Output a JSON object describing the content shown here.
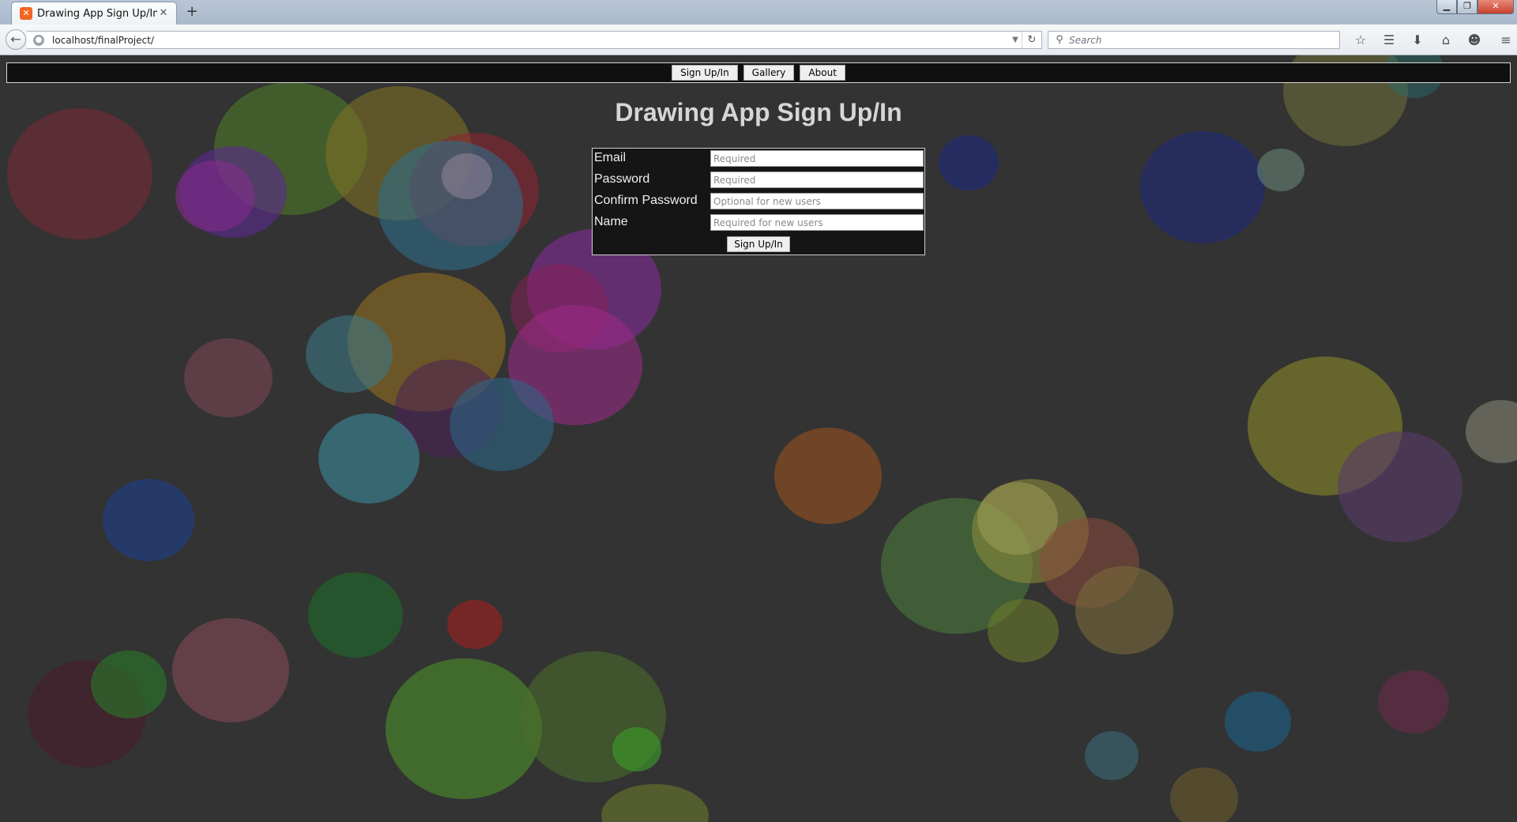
{
  "browser": {
    "tab": {
      "title": "Drawing App Sign Up/In",
      "favicon": "xampp-icon",
      "close_glyph": "✕"
    },
    "new_tab_glyph": "+",
    "url": "localhost/finalProject/",
    "search": {
      "placeholder": "Search"
    },
    "window_controls": {
      "minimize": "▁",
      "maximize": "❐",
      "close": "✕"
    },
    "toolbar_icons": [
      "bookmark-star-icon",
      "reading-list-icon",
      "downloads-icon",
      "home-icon",
      "chat-icon",
      "menu-icon"
    ]
  },
  "site_nav": {
    "items": [
      {
        "label": "Sign Up/In"
      },
      {
        "label": "Gallery"
      },
      {
        "label": "About"
      }
    ]
  },
  "page": {
    "title": "Drawing App Sign Up/In"
  },
  "form": {
    "fields": [
      {
        "label": "Email",
        "placeholder": "Required",
        "value": ""
      },
      {
        "label": "Password",
        "placeholder": "Required",
        "value": ""
      },
      {
        "label": "Confirm Password",
        "placeholder": "Optional for new users",
        "value": ""
      },
      {
        "label": "Name",
        "placeholder": "Required for new users",
        "value": ""
      }
    ],
    "submit_label": "Sign Up/In"
  },
  "colors": {
    "page_background": "#333333",
    "nav_background": "#101010",
    "title_color": "#d6d6d6",
    "form_background": "#151515"
  }
}
